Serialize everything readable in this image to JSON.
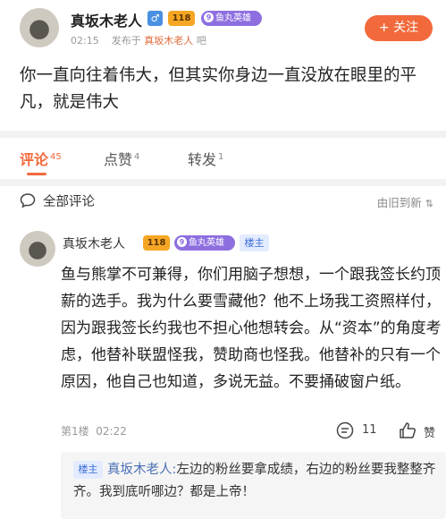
{
  "post": {
    "author": "真坂木老人",
    "gender_icon": "male-icon",
    "level_badge": "118",
    "fan_badge": {
      "level": "9",
      "label": "鱼丸英雄"
    },
    "time": "02:15",
    "published_in_prefix": "发布于",
    "published_in_name": "真坂木老人",
    "published_in_suffix": "吧",
    "follow_label": "+ 关注",
    "content": "你一直向往着伟大，但其实你身边一直没放在眼里的平凡，就是伟大"
  },
  "tabs": [
    {
      "label": "评论",
      "count": "45",
      "active": true
    },
    {
      "label": "点赞",
      "count": "4",
      "active": false
    },
    {
      "label": "转发",
      "count": "1",
      "active": false
    }
  ],
  "section": {
    "title": "全部评论",
    "sort": "由旧到新"
  },
  "comment": {
    "author": "真坂木老人",
    "level_badge": "118",
    "fan_badge": {
      "level": "9",
      "label": "鱼丸英雄"
    },
    "host_tag": "楼主",
    "content": "鱼与熊掌不可兼得，你们用脑子想想，一个跟我签长约顶薪的选手。我为什么要雪藏他？他不上场我工资照样付，因为跟我签长约我也不担心他想转会。从“资本”的角度考虑，他替补联盟怪我，赞助商也怪我。他替补的只有一个原因，他自己也知道，多说无益。不要捅破窗户纸。",
    "floor": "第1楼",
    "time": "02:22",
    "reply_count": "11",
    "like_label": "赞",
    "reply": {
      "host_tag": "楼主",
      "author": "真坂木老人:",
      "text": "左边的粉丝要拿成绩，右边的粉丝要我整整齐齐。我到底听哪边？都是上帝！"
    }
  },
  "colors": {
    "accent": "#f26a3c",
    "fan_badge": "#8e6fe0",
    "level_badge": "#f5a623",
    "host_tag_bg": "#e3ebff"
  }
}
